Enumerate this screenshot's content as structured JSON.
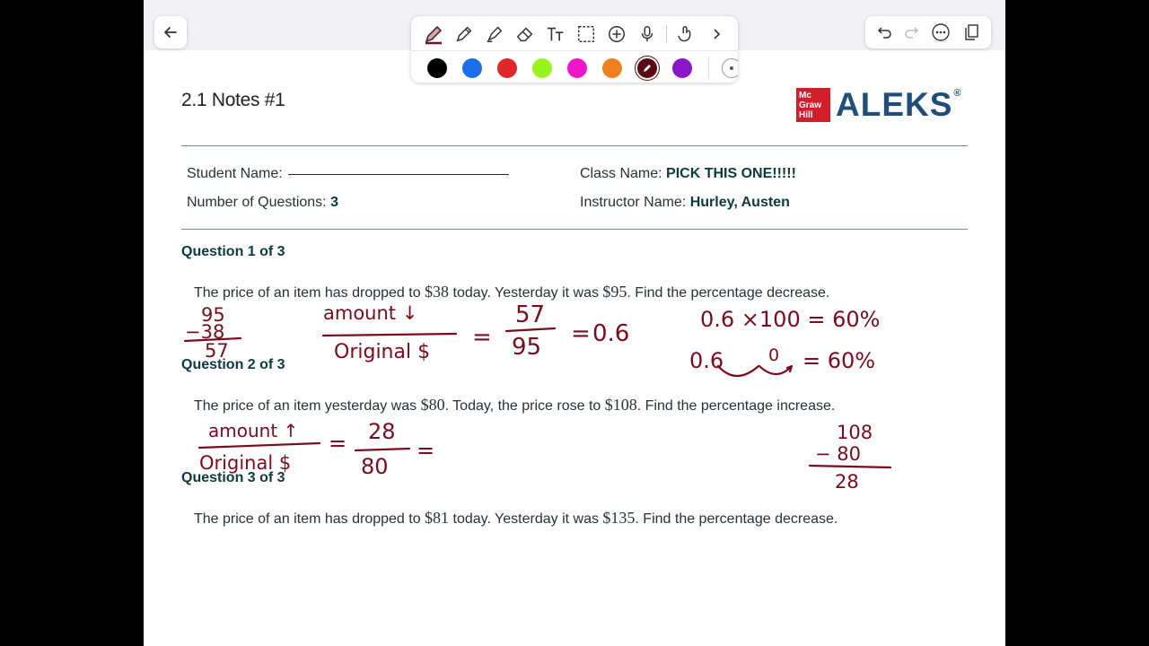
{
  "colors": {
    "ink": "#7a0c1c",
    "heading": "#0d3a40",
    "brand_red": "#d21d2b",
    "brand_blue": "#1f4e79"
  },
  "toolbar": {
    "tools": [
      "pen-icon",
      "pencil-icon",
      "highlighter-icon",
      "eraser-icon",
      "text-icon",
      "lasso-icon",
      "add-icon",
      "microphone-icon",
      "touch-icon",
      "chevron-right-icon"
    ],
    "palette": [
      "#000000",
      "#1a6fe8",
      "#e0262a",
      "#9af21b",
      "#f015c8",
      "#f2801e",
      "#5a0a14",
      "#8a16c8"
    ],
    "selected_color": "#5a0a14"
  },
  "nav": {
    "right_icons": [
      "undo-icon",
      "redo-icon",
      "more-icon",
      "pages-icon"
    ]
  },
  "doc": {
    "title": "2.1 Notes #1",
    "logo": {
      "badge": "Mc Graw Hill",
      "name": "ALEKS",
      "mark": "®"
    },
    "student_label": "Student Name:",
    "num_questions_label": "Number of Questions:",
    "num_questions": "3",
    "class_label": "Class Name:",
    "class_value": "PICK THIS ONE!!!!!",
    "instructor_label": "Instructor Name:",
    "instructor_value": "Hurley, Austen"
  },
  "questions": [
    {
      "heading": "Question 1 of 3",
      "t1": "The price of an item has dropped to ",
      "n1": "$38",
      "t2": " today. Yesterday it was ",
      "n2": "$95",
      "t3": ". Find the percentage decrease."
    },
    {
      "heading": "Question 2 of 3",
      "t1": "The price of an item yesterday was ",
      "n1": "$80",
      "t2": ". Today, the price rose to ",
      "n2": "$108",
      "t3": ". Find the percentage increase."
    },
    {
      "heading": "Question 3 of 3",
      "t1": "The price of an item has dropped to ",
      "n1": "$81",
      "t2": " today. Yesterday it was ",
      "n2": "$135",
      "t3": ". Find the percentage decrease."
    }
  ],
  "ink": {
    "q1": {
      "sub_top": "95",
      "sub_mid": "−38",
      "sub_bot": "57",
      "frac_num": "amount ↓",
      "frac_den": "Original $",
      "eq1": "=",
      "num": "57",
      "den": "95",
      "eq2": "=",
      "result": "0.6",
      "line1": "0.6 ×100 = 60%",
      "line2a": "0.6",
      "line2b": "0",
      "line2c": "= 60%"
    },
    "q2": {
      "frac_num": "amount ↑",
      "frac_den": "Original $",
      "eq1": "=",
      "num": "28",
      "den": "80",
      "eq2": "=",
      "sub_top": "108",
      "sub_mid": "− 80",
      "sub_bot": "28"
    }
  }
}
